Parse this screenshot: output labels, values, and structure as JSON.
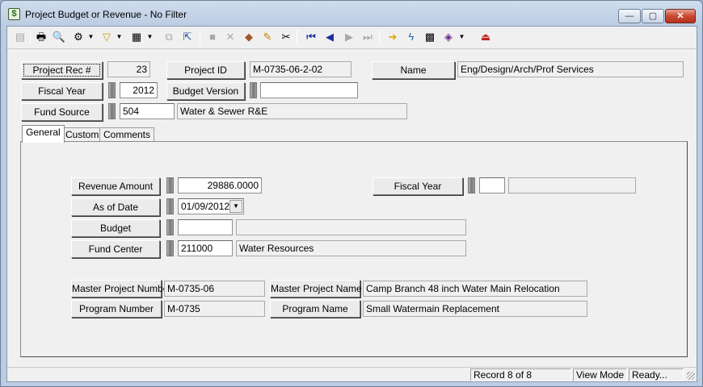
{
  "window": {
    "title": "Project Budget or Revenue - No Filter",
    "controls": {
      "minimize": "—",
      "maximize": "▢",
      "close": "✕"
    }
  },
  "toolbar": {
    "icons": [
      "new-record-icon",
      "print-icon",
      "print-preview-icon",
      "tools-icon",
      "filter-icon",
      "report-icon",
      "copy-record-icon",
      "export-icon",
      "save-icon",
      "delete-icon",
      "stamp-icon",
      "edit-icon",
      "cut-icon",
      "first-record-icon",
      "previous-record-icon",
      "next-record-icon",
      "last-record-icon",
      "go-icon",
      "lightning-icon",
      "calculator-icon",
      "book-icon",
      "exit-icon"
    ]
  },
  "header": {
    "project_rec_label": "Project Rec #",
    "project_rec_value": "23",
    "project_id_label": "Project ID",
    "project_id_value": "M-0735-06-2-02",
    "name_label": "Name",
    "name_value": "Eng/Design/Arch/Prof Services",
    "fiscal_year_label": "Fiscal Year",
    "fiscal_year_value": "2012",
    "budget_version_label": "Budget Version",
    "budget_version_value": "",
    "fund_source_label": "Fund Source",
    "fund_source_code": "504",
    "fund_source_desc": "Water & Sewer R&E"
  },
  "tabs": [
    {
      "label": "General",
      "active": true
    },
    {
      "label": "Custom",
      "active": false
    },
    {
      "label": "Comments",
      "active": false
    }
  ],
  "general": {
    "revenue_amount_label": "Revenue Amount",
    "revenue_amount_value": "29886.0000",
    "fiscal_year_label": "Fiscal Year",
    "fiscal_year_code": "",
    "fiscal_year_desc": "",
    "as_of_date_label": "As of Date",
    "as_of_date_value": "01/09/2012",
    "budget_label": "Budget",
    "budget_code": "",
    "budget_desc": "",
    "fund_center_label": "Fund Center",
    "fund_center_code": "211000",
    "fund_center_desc": "Water Resources",
    "master_project_number_label": "Master Project Number",
    "master_project_number_value": "M-0735-06",
    "master_project_name_label": "Master Project Name",
    "master_project_name_value": "Camp Branch 48 inch Water Main Relocation",
    "program_number_label": "Program Number",
    "program_number_value": "M-0735",
    "program_name_label": "Program Name",
    "program_name_value": "Small Watermain Replacement"
  },
  "status": {
    "record": "Record 8 of 8",
    "mode": "View Mode",
    "state": "Ready..."
  }
}
